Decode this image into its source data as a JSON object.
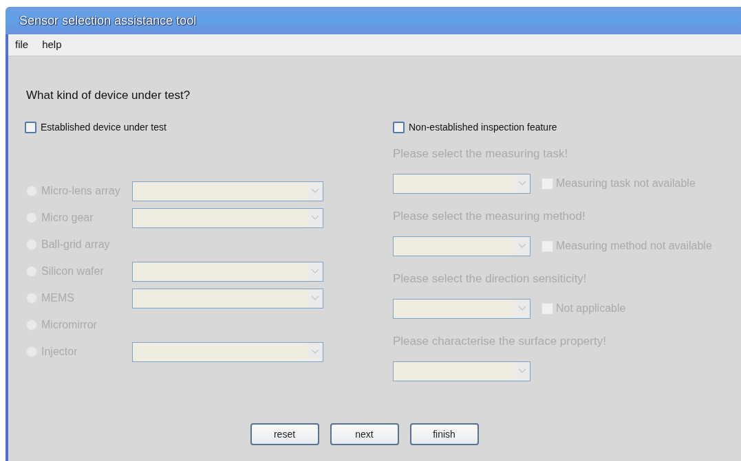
{
  "window": {
    "title": "Sensor selection assistance tool"
  },
  "menu": [
    "file",
    "help"
  ],
  "question": "What kind of device under test?",
  "established": {
    "label": "Established device under test",
    "checked": false
  },
  "device_options": [
    {
      "label": "Micro-lens array",
      "kind": "dropdown",
      "selected": false,
      "disabled": true
    },
    {
      "label": "Micro gear",
      "kind": "dropdown",
      "selected": false,
      "disabled": true
    },
    {
      "label": "Ball-grid array",
      "kind": "plain",
      "selected": false,
      "disabled": true
    },
    {
      "label": "Silicon wafer",
      "kind": "dropdown",
      "selected": false,
      "disabled": true
    },
    {
      "label": "MEMS",
      "kind": "dropdown",
      "selected": false,
      "disabled": true
    },
    {
      "label": "Micromirror",
      "kind": "plain",
      "selected": false,
      "disabled": true
    },
    {
      "label": "Injector",
      "kind": "dropdown",
      "selected": false,
      "disabled": true
    }
  ],
  "non_established": {
    "label": "Non-established inspection feature",
    "checked": false
  },
  "steps": [
    {
      "prompt": "Please select the measuring task!",
      "disabled": true,
      "option": {
        "label": "Measuring task not available",
        "checked": false
      }
    },
    {
      "prompt": "Please select the measuring method!",
      "disabled": true,
      "option": {
        "label": "Measuring method not available",
        "checked": false
      }
    },
    {
      "prompt": "Please select the direction sensiticity!",
      "disabled": true,
      "option": {
        "label": "Not applicable",
        "checked": false
      }
    },
    {
      "prompt": "Please characterise the surface property!",
      "disabled": true
    }
  ],
  "buttons": [
    "reset",
    "next",
    "finish"
  ]
}
